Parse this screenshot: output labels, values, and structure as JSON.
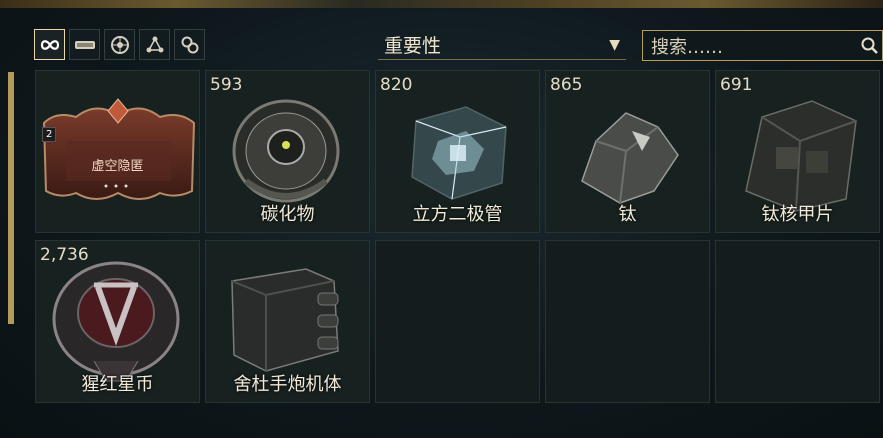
{
  "toolbar": {
    "filters": [
      {
        "icon": "infinity-icon"
      },
      {
        "icon": "bar-icon"
      },
      {
        "icon": "orb-icon"
      },
      {
        "icon": "molecule-icon"
      },
      {
        "icon": "gear-link-icon"
      }
    ]
  },
  "sort": {
    "label": "重要性",
    "arrow": "▼"
  },
  "search": {
    "placeholder": "搜索……"
  },
  "items": [
    {
      "count": "",
      "name": "",
      "badge": "2",
      "card_title": "虚空隐匿",
      "icon": "void-relic-card-icon"
    },
    {
      "count": "593",
      "name": "碳化物",
      "icon": "carbide-disc-icon"
    },
    {
      "count": "820",
      "name": "立方二极管",
      "icon": "cubic-diode-icon"
    },
    {
      "count": "865",
      "name": "钛",
      "icon": "titanium-ore-icon"
    },
    {
      "count": "691",
      "name": "钛核甲片",
      "icon": "titanium-plating-icon"
    },
    {
      "count": "2,736",
      "name": "猩红星币",
      "icon": "crimson-coin-icon"
    },
    {
      "count": "",
      "name": "舍杜手炮机体",
      "icon": "pistol-receiver-icon"
    },
    {
      "count": "",
      "name": "",
      "icon": ""
    },
    {
      "count": "",
      "name": "",
      "icon": ""
    },
    {
      "count": "",
      "name": "",
      "icon": ""
    }
  ]
}
